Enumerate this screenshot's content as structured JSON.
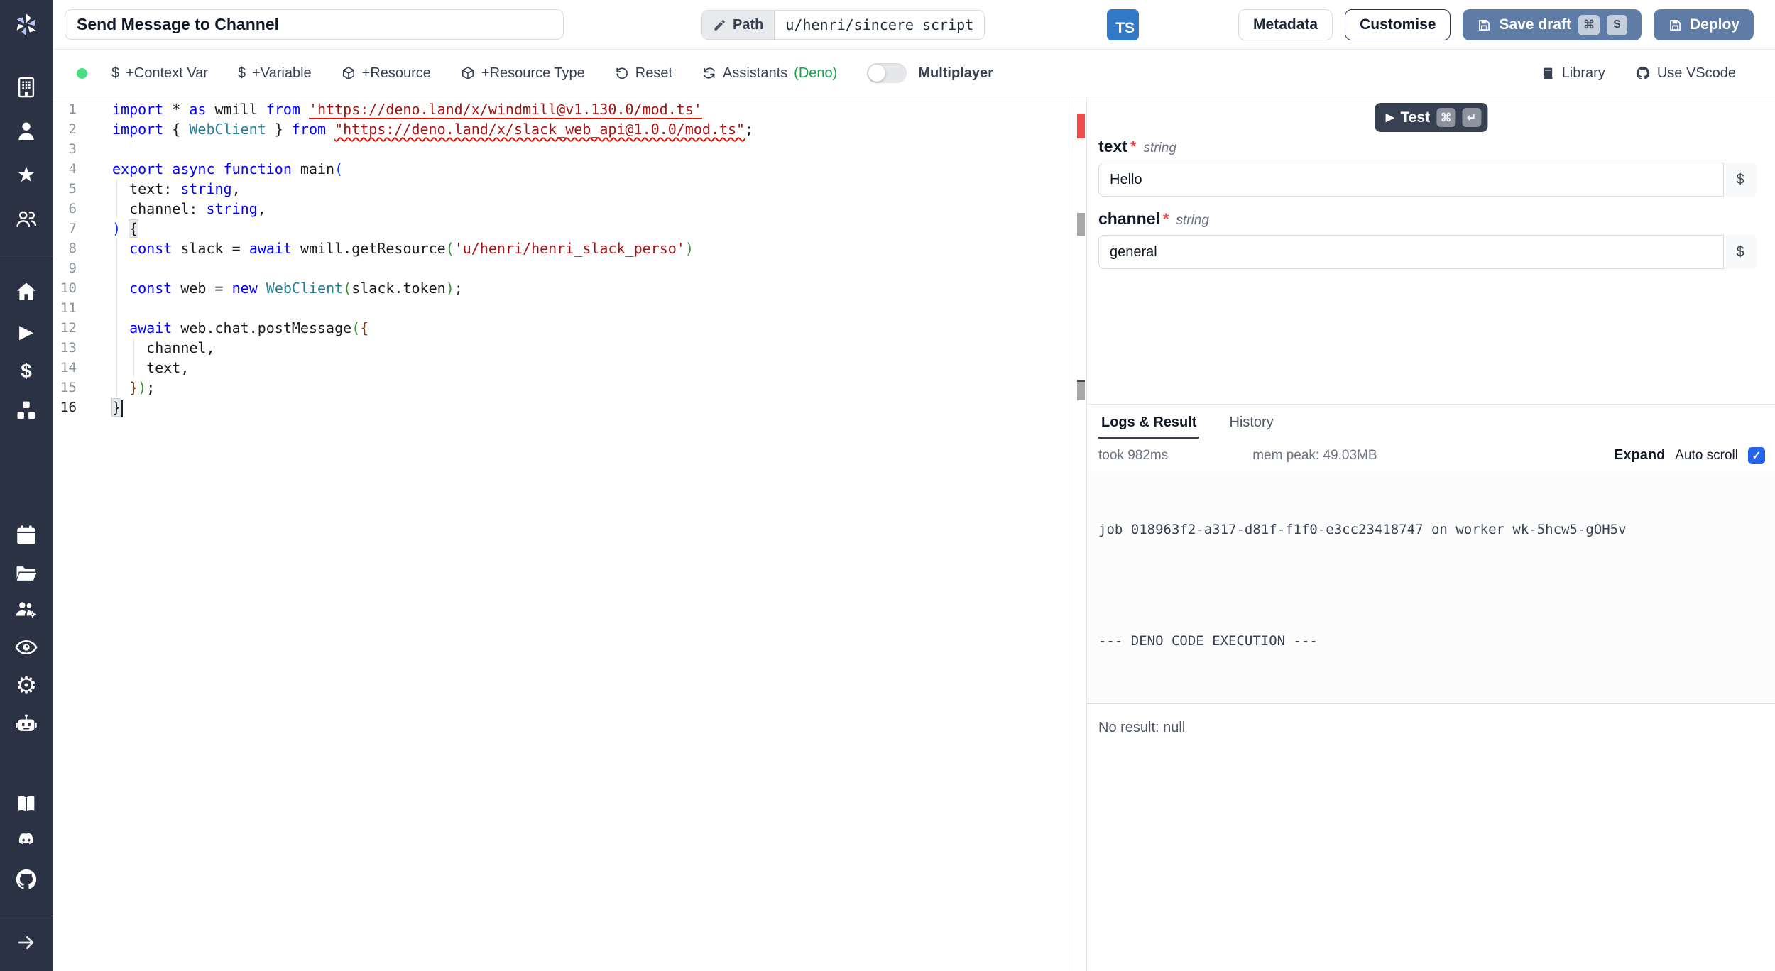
{
  "header": {
    "title": "Send Message to Channel",
    "path_label": "Path",
    "path_value": "u/henri/sincere_script",
    "lang_badge": "TS",
    "metadata": "Metadata",
    "customise": "Customise",
    "save_draft": "Save draft",
    "save_kbd": [
      "⌘",
      "S"
    ],
    "deploy": "Deploy"
  },
  "toolbar": {
    "dollar": "$",
    "context_var": "+Context Var",
    "variable": "+Variable",
    "resource": "+Resource",
    "resource_type": "+Resource Type",
    "reset": "Reset",
    "assistants": "Assistants",
    "assistants_lang": "(Deno)",
    "multiplayer": "Multiplayer",
    "library": "Library",
    "vscode": "Use VScode"
  },
  "editor": {
    "lines": [
      {
        "n": "1",
        "segs": [
          [
            "k",
            "import"
          ],
          [
            "d",
            " * "
          ],
          [
            "k",
            "as"
          ],
          [
            "d",
            " wmill "
          ],
          [
            "k",
            "from"
          ],
          [
            "d",
            " "
          ],
          [
            "su",
            "'https://deno.land/x/windmill@v1.130.0/mod.ts'"
          ]
        ]
      },
      {
        "n": "2",
        "segs": [
          [
            "k",
            "import"
          ],
          [
            "d",
            " { "
          ],
          [
            "t",
            "WebClient"
          ],
          [
            "d",
            " } "
          ],
          [
            "k",
            "from"
          ],
          [
            "d",
            " "
          ],
          [
            "sw",
            "\"https://deno.land/x/slack_web_api@1.0.0/mod.ts\""
          ],
          [
            "d",
            ";"
          ]
        ]
      },
      {
        "n": "3",
        "segs": []
      },
      {
        "n": "4",
        "segs": [
          [
            "k",
            "export"
          ],
          [
            "d",
            " "
          ],
          [
            "k",
            "async"
          ],
          [
            "d",
            " "
          ],
          [
            "k",
            "function"
          ],
          [
            "d",
            " main"
          ],
          [
            "p1",
            "("
          ]
        ]
      },
      {
        "n": "5",
        "segs": [
          [
            "d",
            "  text: "
          ],
          [
            "k",
            "string"
          ],
          [
            "d",
            ","
          ]
        ]
      },
      {
        "n": "6",
        "segs": [
          [
            "d",
            "  channel: "
          ],
          [
            "k",
            "string"
          ],
          [
            "d",
            ","
          ]
        ]
      },
      {
        "n": "7",
        "segs": [
          [
            "p1",
            ") "
          ],
          [
            "bm",
            "{"
          ]
        ]
      },
      {
        "n": "8",
        "segs": [
          [
            "d",
            "  "
          ],
          [
            "k",
            "const"
          ],
          [
            "d",
            " slack = "
          ],
          [
            "k",
            "await"
          ],
          [
            "d",
            " wmill.getResource"
          ],
          [
            "p2",
            "("
          ],
          [
            "s",
            "'u/henri/henri_slack_perso'"
          ],
          [
            "p2",
            ")"
          ]
        ]
      },
      {
        "n": "9",
        "segs": []
      },
      {
        "n": "10",
        "segs": [
          [
            "d",
            "  "
          ],
          [
            "k",
            "const"
          ],
          [
            "d",
            " web = "
          ],
          [
            "k",
            "new"
          ],
          [
            "d",
            " "
          ],
          [
            "t",
            "WebClient"
          ],
          [
            "p2",
            "("
          ],
          [
            "d",
            "slack.token"
          ],
          [
            "p2",
            ")"
          ],
          [
            "d",
            ";"
          ]
        ]
      },
      {
        "n": "11",
        "segs": []
      },
      {
        "n": "12",
        "segs": [
          [
            "d",
            "  "
          ],
          [
            "k",
            "await"
          ],
          [
            "d",
            " web.chat.postMessage"
          ],
          [
            "p2",
            "("
          ],
          [
            "p3",
            "{"
          ]
        ]
      },
      {
        "n": "13",
        "segs": [
          [
            "d",
            "    channel,"
          ]
        ]
      },
      {
        "n": "14",
        "segs": [
          [
            "d",
            "    text,"
          ]
        ]
      },
      {
        "n": "15",
        "segs": [
          [
            "d",
            "  "
          ],
          [
            "p3",
            "}"
          ],
          [
            "p2",
            ")"
          ],
          [
            "d",
            ";"
          ]
        ]
      },
      {
        "n": "16",
        "segs": [
          [
            "bm",
            "}"
          ]
        ],
        "cursor": true,
        "active": true
      }
    ]
  },
  "form": {
    "test": "Test",
    "test_play": "▶",
    "test_kbd": [
      "⌘",
      "↵"
    ],
    "fields": [
      {
        "name": "text",
        "required": "*",
        "type": "string",
        "value": "Hello",
        "suffix": "$"
      },
      {
        "name": "channel",
        "required": "*",
        "type": "string",
        "value": "general",
        "suffix": "$"
      }
    ]
  },
  "logs": {
    "tab_logs": "Logs & Result",
    "tab_history": "History",
    "took": "took 982ms",
    "mem": "mem peak: 49.03MB",
    "expand": "Expand",
    "autoscroll": "Auto scroll",
    "check": "✓",
    "job_line": "job 018963f2-a317-d81f-f1f0-e3cc23418747 on worker wk-5hcw5-gOH5v",
    "exec_line": "--- DENO CODE EXECUTION ---",
    "result": "No result: null"
  },
  "sidebar": {
    "icons": [
      "windmill-logo",
      "building",
      "user",
      "star",
      "team",
      "home",
      "runs",
      "variables",
      "resources",
      "schedules",
      "folders",
      "groups",
      "audit-logs",
      "settings",
      "workers",
      "docs",
      "discord",
      "github",
      "collapse-arrow"
    ]
  },
  "colors": {
    "sidebar": "#2b3244",
    "primary_button": "#5e7ca6",
    "test_button": "#374151",
    "deno_green": "#16a34a",
    "checkbox": "#2563eb",
    "ts_badge": "#3178c6",
    "error": "#e51400",
    "status_dot": "#4ade80"
  }
}
